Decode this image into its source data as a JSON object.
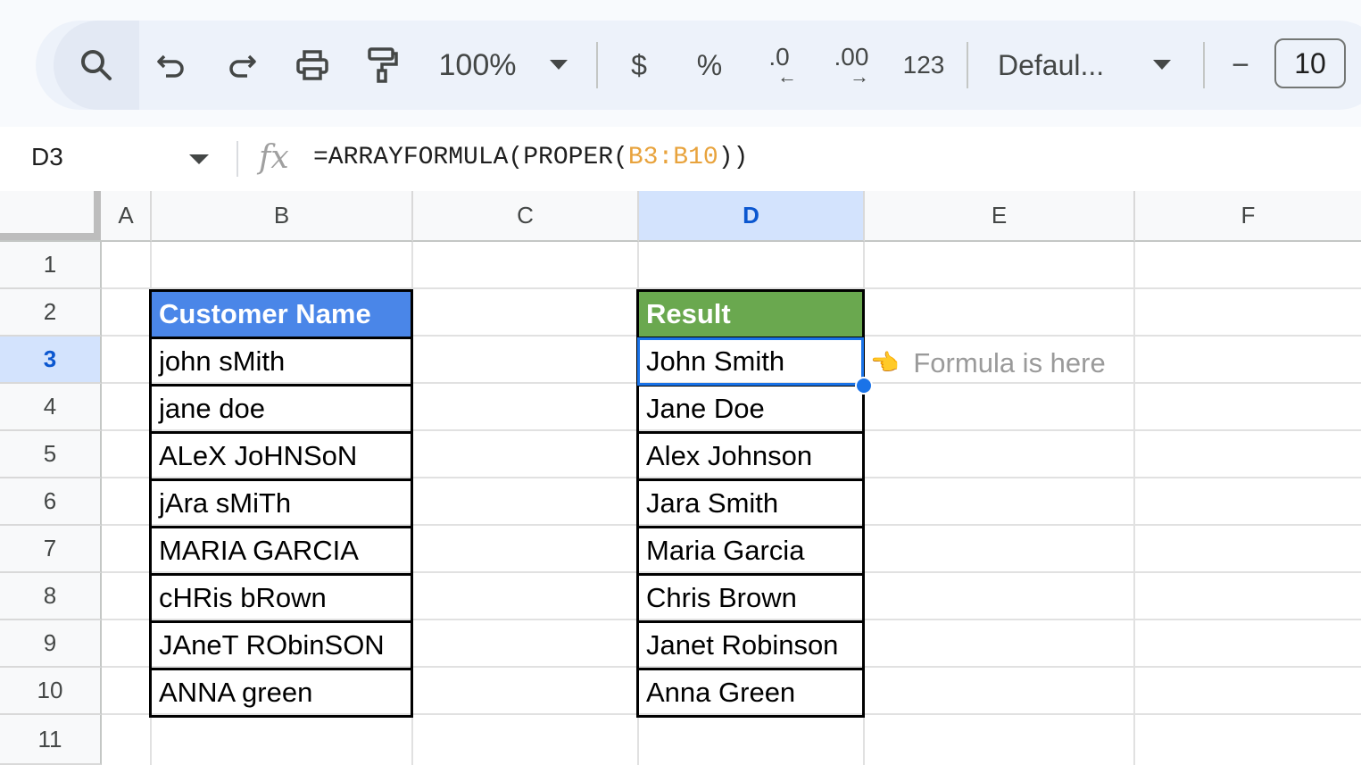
{
  "toolbar": {
    "zoom": "100%",
    "currency": "$",
    "percent": "%",
    "decrease_decimal": ".0",
    "increase_decimal": ".00",
    "number_format": "123",
    "font": "Defaul...",
    "decrease_font_size": "−",
    "font_size": "10",
    "icons": [
      "search-icon",
      "undo-icon",
      "redo-icon",
      "print-icon",
      "paint-format-icon",
      "chevron-down-icon"
    ]
  },
  "formula_bar": {
    "name_box": "D3",
    "fx": "fx",
    "formula_prefix": "=ARRAYFORMULA(PROPER(",
    "formula_ref": "B3:B10",
    "formula_suffix": "))"
  },
  "grid": {
    "columns": [
      "A",
      "B",
      "C",
      "D",
      "E",
      "F"
    ],
    "rows": [
      "1",
      "2",
      "3",
      "4",
      "5",
      "6",
      "7",
      "8",
      "9",
      "10",
      "11"
    ],
    "selected_column": "D",
    "selected_row": "3",
    "customer_header": "Customer Name",
    "result_header": "Result",
    "customer_names": [
      "john sMith",
      "jane doe",
      "ALeX JoHNSoN",
      "jAra sMiTh",
      "MARIA GARCIA",
      "cHRis bRown",
      "JAneT RObinSON",
      "ANNA green"
    ],
    "results": [
      "John Smith",
      "Jane Doe",
      "Alex Johnson",
      "Jara Smith",
      "Maria Garcia",
      "Chris Brown",
      "Janet Robinson",
      "Anna Green"
    ],
    "note_icon": "👈",
    "note": "Formula is here",
    "colors": {
      "customer_header_bg": "#4a86e8",
      "result_header_bg": "#6aa84f",
      "selection": "#1a73e8"
    }
  }
}
